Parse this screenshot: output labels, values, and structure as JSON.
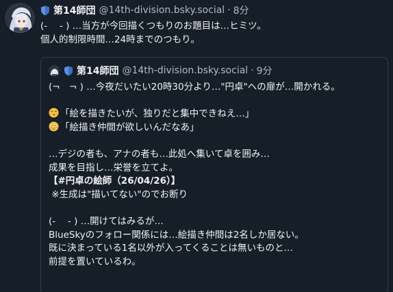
{
  "post": {
    "display_name": "第14師団",
    "handle": "@14th-division.bsky.social",
    "separator": "·",
    "time": "8分",
    "text_lines": [
      "(-　 - ) …当方が今回描くつもりのお題目は…ヒミツ。",
      "個人的制限時間…24時までのつもり。"
    ]
  },
  "quote": {
    "display_name": "第14師団",
    "handle": "@14th-division.bsky.social",
    "separator": "·",
    "time": "9分",
    "line_1": "(¬　¬ ) …今夜だいたい20時30分より…\"円卓\"への扉が…開かれる。",
    "line_3": "「絵を描きたいが、独りだと集中できねえ…」",
    "line_4": "「絵描き仲間が欲しいんだなあ」",
    "line_6": "…デジの者も、アナの者も…此処へ集いて卓を囲み…",
    "line_7": "成果を目指し…栄誉を立てよ。",
    "line_8": "【#円卓の絵師（26/04/26）】",
    "line_9": " ※生成は\"描いてない\"のでお断り",
    "line_11": "(-　 - ) …開けてはみるが…",
    "line_12": "BlueSkyのフォロー関係には…絵描き仲間は2名しか居ない。",
    "line_13": "既に決まっている1名以外が入ってくることは無いものと…",
    "line_14": "前提を置いているわ。"
  },
  "icons": {
    "avatar": "anime-character-avatar",
    "shield": "shield-icon",
    "emoji_1": "blowing-kiss-face-emoji",
    "emoji_2": "flushed-face-emoji"
  },
  "colors": {
    "background": "#161e27",
    "text": "#f1f3f5",
    "muted": "#aebbc9",
    "border": "#2e4052",
    "shield": "#5c8fe6"
  }
}
